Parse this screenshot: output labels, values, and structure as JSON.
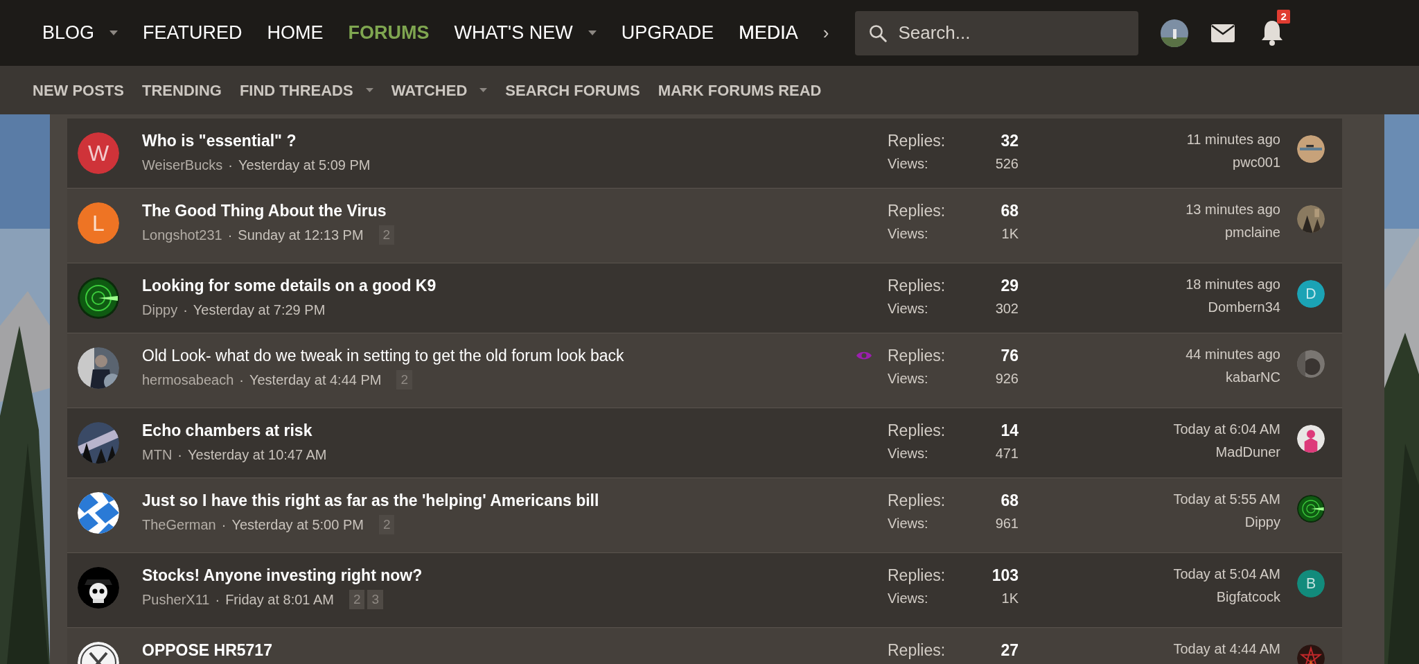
{
  "nav": {
    "items": [
      {
        "label": "BLOG",
        "dropdown": true,
        "selected": false
      },
      {
        "label": "FEATURED",
        "dropdown": false,
        "selected": false
      },
      {
        "label": "HOME",
        "dropdown": false,
        "selected": false
      },
      {
        "label": "FORUMS",
        "dropdown": false,
        "selected": true
      },
      {
        "label": "WHAT'S NEW",
        "dropdown": true,
        "selected": false
      },
      {
        "label": "UPGRADE",
        "dropdown": false,
        "selected": false
      },
      {
        "label": "MEDIA",
        "dropdown": false,
        "selected": false,
        "faded": true
      }
    ],
    "more": "›",
    "search": {
      "placeholder": "Search..."
    },
    "alerts_badge": "2"
  },
  "subnav": [
    {
      "label": "NEW POSTS",
      "dropdown": false
    },
    {
      "label": "TRENDING",
      "dropdown": false
    },
    {
      "label": "FIND THREADS",
      "dropdown": true
    },
    {
      "label": "WATCHED",
      "dropdown": true
    },
    {
      "label": "SEARCH FORUMS",
      "dropdown": false
    },
    {
      "label": "MARK FORUMS READ",
      "dropdown": false
    }
  ],
  "threads": [
    {
      "title": "Who is \"essential\" ?",
      "unread": true,
      "author": "WeiserBucks",
      "sep": "·",
      "date": "Yesterday at 5:09 PM",
      "avatar": {
        "kind": "letter",
        "letter": "W",
        "color": "#cf3339"
      },
      "replies_label": "Replies:",
      "replies": "32",
      "views_label": "Views:",
      "views": "526",
      "last_time": "11 minutes ago",
      "last_user": "pwc001",
      "last_avatar": {
        "kind": "picture"
      }
    },
    {
      "title": "The Good Thing About the Virus",
      "unread": true,
      "author": "Longshot231",
      "sep": "·",
      "date": "Sunday at 12:13 PM",
      "pages": [
        "2"
      ],
      "avatar": {
        "kind": "letter",
        "letter": "L",
        "color": "#ee7424"
      },
      "replies_label": "Replies:",
      "replies": "68",
      "views_label": "Views:",
      "views": "1K",
      "last_time": "13 minutes ago",
      "last_user": "pmclaine",
      "last_avatar": {
        "kind": "picture"
      }
    },
    {
      "title": "Looking for some details on a good K9",
      "unread": true,
      "author": "Dippy",
      "sep": "·",
      "date": "Yesterday at 7:29 PM",
      "avatar": {
        "kind": "picture"
      },
      "replies_label": "Replies:",
      "replies": "29",
      "views_label": "Views:",
      "views": "302",
      "last_time": "18 minutes ago",
      "last_user": "Dombern34",
      "last_avatar": {
        "kind": "letter",
        "letter": "D",
        "color": "#1ba3b5"
      }
    },
    {
      "title": "Old Look- what do we tweak in setting to get the old forum look back",
      "unread": false,
      "watched": true,
      "author": "hermosabeach",
      "sep": "·",
      "date": "Yesterday at 4:44 PM",
      "pages": [
        "2"
      ],
      "avatar": {
        "kind": "picture"
      },
      "replies_label": "Replies:",
      "replies": "76",
      "views_label": "Views:",
      "views": "926",
      "last_time": "44 minutes ago",
      "last_user": "kabarNC",
      "last_avatar": {
        "kind": "picture"
      }
    },
    {
      "title": "Echo chambers at risk",
      "unread": true,
      "author": "MTN",
      "sep": "·",
      "date": "Yesterday at 10:47 AM",
      "avatar": {
        "kind": "picture"
      },
      "replies_label": "Replies:",
      "replies": "14",
      "views_label": "Views:",
      "views": "471",
      "last_time": "Today at 6:04 AM",
      "last_user": "MadDuner",
      "last_avatar": {
        "kind": "picture"
      }
    },
    {
      "title": "Just so I have this right as far as the 'helping' Americans bill",
      "unread": true,
      "author": "TheGerman",
      "sep": "·",
      "date": "Yesterday at 5:00 PM",
      "pages": [
        "2"
      ],
      "avatar": {
        "kind": "picture"
      },
      "replies_label": "Replies:",
      "replies": "68",
      "views_label": "Views:",
      "views": "961",
      "last_time": "Today at 5:55 AM",
      "last_user": "Dippy",
      "last_avatar": {
        "kind": "picture"
      }
    },
    {
      "title": "Stocks! Anyone investing right now?",
      "unread": true,
      "author": "PusherX11",
      "sep": "·",
      "date": "Friday at 8:01 AM",
      "pages": [
        "2",
        "3"
      ],
      "avatar": {
        "kind": "picture"
      },
      "replies_label": "Replies:",
      "replies": "103",
      "views_label": "Views:",
      "views": "1K",
      "last_time": "Today at 5:04 AM",
      "last_user": "Bigfatcock",
      "last_avatar": {
        "kind": "letter",
        "letter": "B",
        "color": "#128b7c"
      }
    },
    {
      "title": "OPPOSE HR5717",
      "unread": true,
      "avatar": {
        "kind": "picture"
      },
      "replies_label": "Replies:",
      "replies": "27",
      "last_time": "Today at 4:44 AM",
      "last_avatar": {
        "kind": "picture"
      }
    }
  ]
}
